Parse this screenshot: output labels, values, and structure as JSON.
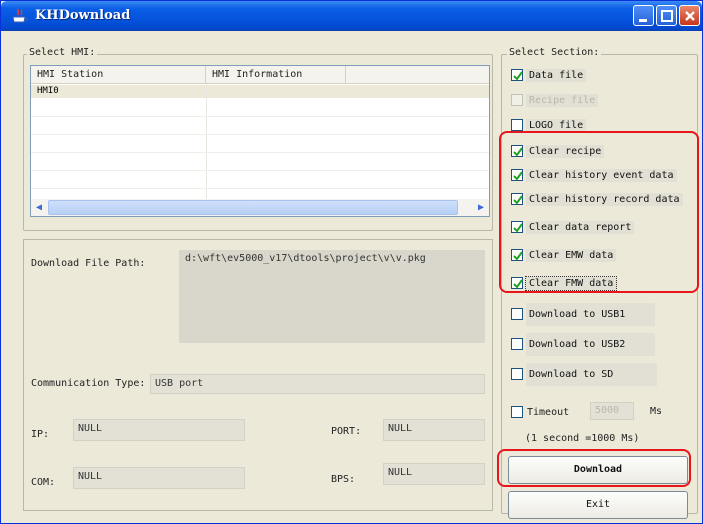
{
  "window": {
    "title": "KHDownload"
  },
  "select_hmi": {
    "label": "Select HMI:",
    "columns": [
      "HMI Station",
      "HMI Information"
    ],
    "rows": [
      {
        "station": "HMI0",
        "info": ""
      }
    ]
  },
  "download": {
    "path_label": "Download File Path:",
    "path_value": "d:\\wft\\ev5000_v17\\dtools\\project\\v\\v.pkg",
    "comm_label": "Communication Type:",
    "comm_value": "USB port",
    "ip_label": "IP:",
    "ip_value": "NULL",
    "port_label": "PORT:",
    "port_value": "NULL",
    "com_label": "COM:",
    "com_value": "NULL",
    "bps_label": "BPS:",
    "bps_value": "NULL"
  },
  "select_section": {
    "label": "Select Section:",
    "items": [
      {
        "label": "Data file",
        "checked": true,
        "enabled": true
      },
      {
        "label": "Recipe file",
        "checked": false,
        "enabled": false
      },
      {
        "label": "LOGO file",
        "checked": false,
        "enabled": true
      },
      {
        "label": "Clear recipe",
        "checked": true,
        "enabled": true
      },
      {
        "label": "Clear history event data",
        "checked": true,
        "enabled": true
      },
      {
        "label": "Clear history record data",
        "checked": true,
        "enabled": true
      },
      {
        "label": "Clear data report",
        "checked": true,
        "enabled": true
      },
      {
        "label": "Clear EMW data",
        "checked": true,
        "enabled": true
      },
      {
        "label": "Clear FMW data",
        "checked": true,
        "enabled": true
      },
      {
        "label": "Download to USB1",
        "checked": false,
        "enabled": true
      },
      {
        "label": "Download to USB2",
        "checked": false,
        "enabled": true
      },
      {
        "label": "Download to SD",
        "checked": false,
        "enabled": true
      }
    ],
    "timeout_label": "Timeout",
    "timeout_value": "5000",
    "timeout_unit": "Ms",
    "timeout_note": "(1 second =1000 Ms)"
  },
  "buttons": {
    "download": "Download",
    "exit": "Exit"
  },
  "colors": {
    "highlight": "#e8161b",
    "titlebar": "#0654dd"
  }
}
